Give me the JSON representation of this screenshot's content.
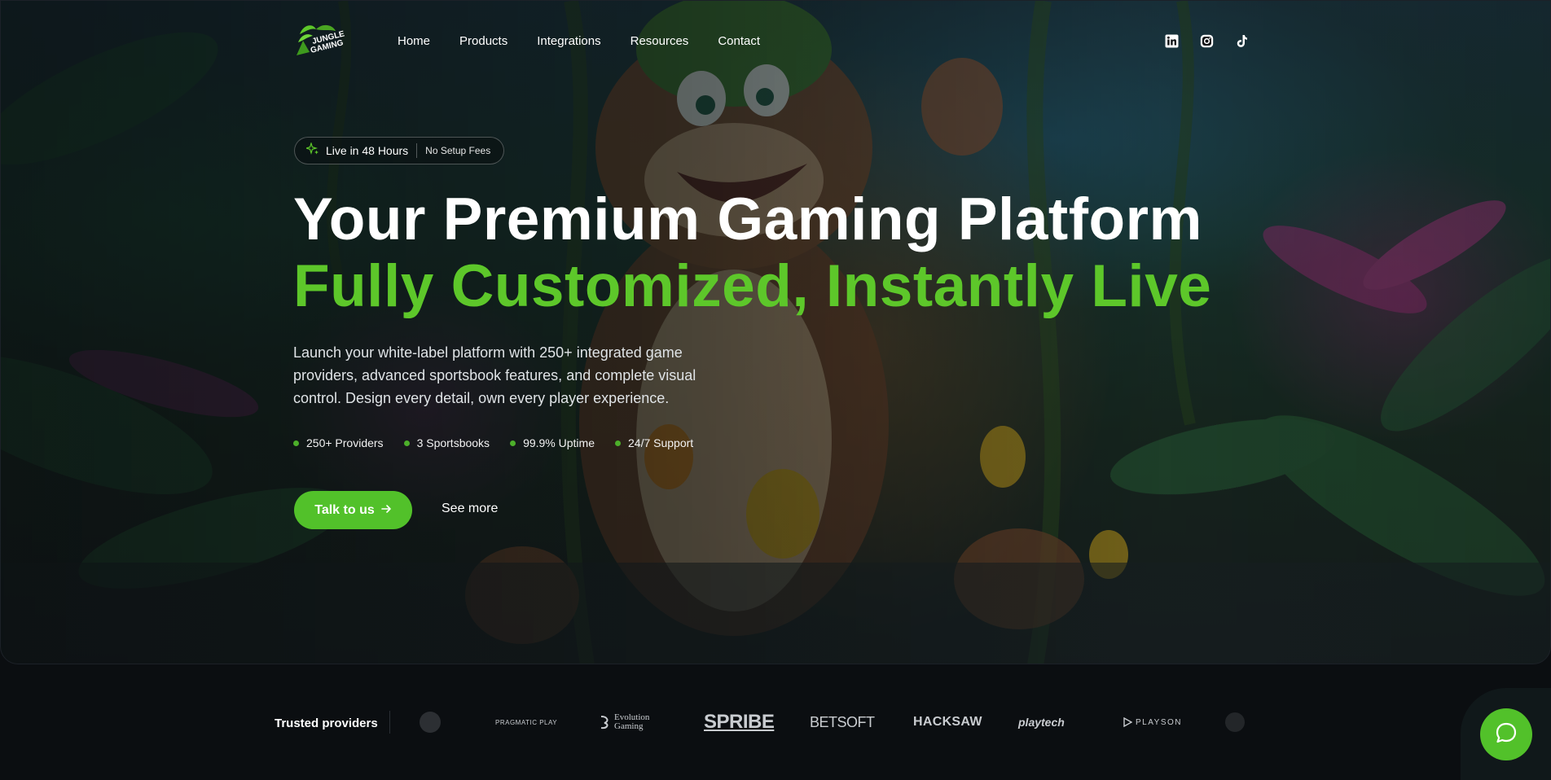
{
  "header": {
    "logo_text": [
      "JUNGLE",
      "GAMING"
    ],
    "nav": [
      "Home",
      "Products",
      "Integrations",
      "Resources",
      "Contact"
    ],
    "socials": [
      "linkedin-icon",
      "instagram-icon",
      "tiktok-icon"
    ]
  },
  "hero": {
    "badge_primary": "Live in 48 Hours",
    "badge_secondary": "No Setup Fees",
    "title_line1": "Your Premium Gaming Platform",
    "title_line2": "Fully Customized, Instantly Live",
    "description": "Launch your white-label platform with 250+ integrated game providers, advanced sportsbook features, and complete visual control. Design every detail, own every player experience.",
    "features": [
      "250+ Providers",
      "3 Sportsbooks",
      "99.9% Uptime",
      "24/7 Support"
    ],
    "cta_primary": "Talk to us",
    "cta_secondary": "See more"
  },
  "providers": {
    "label": "Trusted providers",
    "logos": [
      "PRAGMATIC PLAY",
      "Evolution Gaming",
      "SPRIBE",
      "BETSOFT",
      "HACKSAW",
      "playtech",
      "PLAYSON"
    ]
  },
  "colors": {
    "accent": "#52c12a",
    "accent_text": "#5dc72a",
    "background": "#0b0e11"
  }
}
